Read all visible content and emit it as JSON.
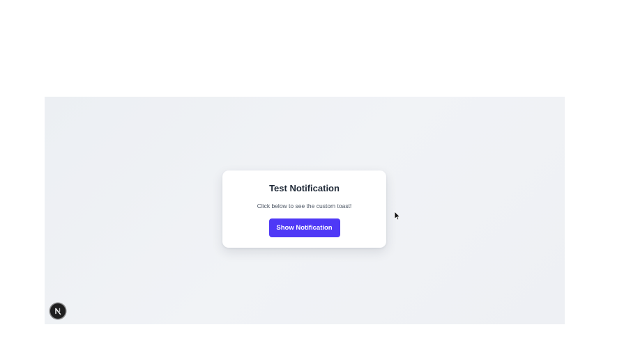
{
  "card": {
    "title": "Test Notification",
    "subtitle": "Click below to see the custom toast!",
    "button_label": "Show Notification"
  },
  "dev_badge": {
    "icon": "nextjs-logo-icon",
    "letter": "N"
  },
  "cursor": {
    "icon": "mouse-pointer-icon"
  },
  "colors": {
    "accent": "#4f39f6",
    "card_background": "#ffffff",
    "viewport_background": "#eef0f4",
    "title_text": "#1f2937",
    "subtitle_text": "#4b5563"
  }
}
